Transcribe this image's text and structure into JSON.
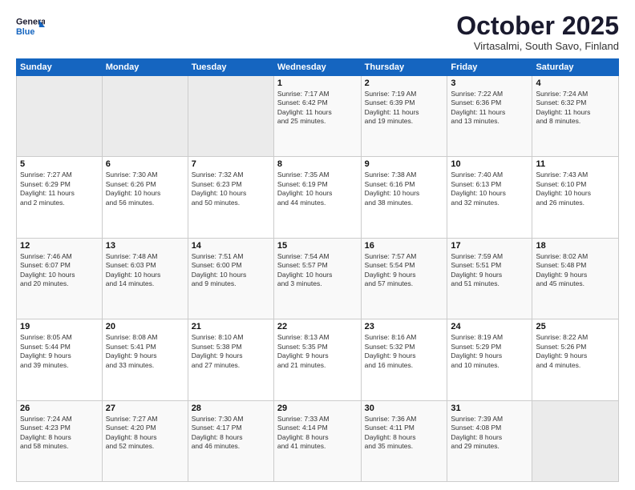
{
  "logo": {
    "line1": "General",
    "line2": "Blue"
  },
  "title": "October 2025",
  "subtitle": "Virtasalmi, South Savo, Finland",
  "days_of_week": [
    "Sunday",
    "Monday",
    "Tuesday",
    "Wednesday",
    "Thursday",
    "Friday",
    "Saturday"
  ],
  "weeks": [
    [
      {
        "day": "",
        "info": ""
      },
      {
        "day": "",
        "info": ""
      },
      {
        "day": "",
        "info": ""
      },
      {
        "day": "1",
        "info": "Sunrise: 7:17 AM\nSunset: 6:42 PM\nDaylight: 11 hours\nand 25 minutes."
      },
      {
        "day": "2",
        "info": "Sunrise: 7:19 AM\nSunset: 6:39 PM\nDaylight: 11 hours\nand 19 minutes."
      },
      {
        "day": "3",
        "info": "Sunrise: 7:22 AM\nSunset: 6:36 PM\nDaylight: 11 hours\nand 13 minutes."
      },
      {
        "day": "4",
        "info": "Sunrise: 7:24 AM\nSunset: 6:32 PM\nDaylight: 11 hours\nand 8 minutes."
      }
    ],
    [
      {
        "day": "5",
        "info": "Sunrise: 7:27 AM\nSunset: 6:29 PM\nDaylight: 11 hours\nand 2 minutes."
      },
      {
        "day": "6",
        "info": "Sunrise: 7:30 AM\nSunset: 6:26 PM\nDaylight: 10 hours\nand 56 minutes."
      },
      {
        "day": "7",
        "info": "Sunrise: 7:32 AM\nSunset: 6:23 PM\nDaylight: 10 hours\nand 50 minutes."
      },
      {
        "day": "8",
        "info": "Sunrise: 7:35 AM\nSunset: 6:19 PM\nDaylight: 10 hours\nand 44 minutes."
      },
      {
        "day": "9",
        "info": "Sunrise: 7:38 AM\nSunset: 6:16 PM\nDaylight: 10 hours\nand 38 minutes."
      },
      {
        "day": "10",
        "info": "Sunrise: 7:40 AM\nSunset: 6:13 PM\nDaylight: 10 hours\nand 32 minutes."
      },
      {
        "day": "11",
        "info": "Sunrise: 7:43 AM\nSunset: 6:10 PM\nDaylight: 10 hours\nand 26 minutes."
      }
    ],
    [
      {
        "day": "12",
        "info": "Sunrise: 7:46 AM\nSunset: 6:07 PM\nDaylight: 10 hours\nand 20 minutes."
      },
      {
        "day": "13",
        "info": "Sunrise: 7:48 AM\nSunset: 6:03 PM\nDaylight: 10 hours\nand 14 minutes."
      },
      {
        "day": "14",
        "info": "Sunrise: 7:51 AM\nSunset: 6:00 PM\nDaylight: 10 hours\nand 9 minutes."
      },
      {
        "day": "15",
        "info": "Sunrise: 7:54 AM\nSunset: 5:57 PM\nDaylight: 10 hours\nand 3 minutes."
      },
      {
        "day": "16",
        "info": "Sunrise: 7:57 AM\nSunset: 5:54 PM\nDaylight: 9 hours\nand 57 minutes."
      },
      {
        "day": "17",
        "info": "Sunrise: 7:59 AM\nSunset: 5:51 PM\nDaylight: 9 hours\nand 51 minutes."
      },
      {
        "day": "18",
        "info": "Sunrise: 8:02 AM\nSunset: 5:48 PM\nDaylight: 9 hours\nand 45 minutes."
      }
    ],
    [
      {
        "day": "19",
        "info": "Sunrise: 8:05 AM\nSunset: 5:44 PM\nDaylight: 9 hours\nand 39 minutes."
      },
      {
        "day": "20",
        "info": "Sunrise: 8:08 AM\nSunset: 5:41 PM\nDaylight: 9 hours\nand 33 minutes."
      },
      {
        "day": "21",
        "info": "Sunrise: 8:10 AM\nSunset: 5:38 PM\nDaylight: 9 hours\nand 27 minutes."
      },
      {
        "day": "22",
        "info": "Sunrise: 8:13 AM\nSunset: 5:35 PM\nDaylight: 9 hours\nand 21 minutes."
      },
      {
        "day": "23",
        "info": "Sunrise: 8:16 AM\nSunset: 5:32 PM\nDaylight: 9 hours\nand 16 minutes."
      },
      {
        "day": "24",
        "info": "Sunrise: 8:19 AM\nSunset: 5:29 PM\nDaylight: 9 hours\nand 10 minutes."
      },
      {
        "day": "25",
        "info": "Sunrise: 8:22 AM\nSunset: 5:26 PM\nDaylight: 9 hours\nand 4 minutes."
      }
    ],
    [
      {
        "day": "26",
        "info": "Sunrise: 7:24 AM\nSunset: 4:23 PM\nDaylight: 8 hours\nand 58 minutes."
      },
      {
        "day": "27",
        "info": "Sunrise: 7:27 AM\nSunset: 4:20 PM\nDaylight: 8 hours\nand 52 minutes."
      },
      {
        "day": "28",
        "info": "Sunrise: 7:30 AM\nSunset: 4:17 PM\nDaylight: 8 hours\nand 46 minutes."
      },
      {
        "day": "29",
        "info": "Sunrise: 7:33 AM\nSunset: 4:14 PM\nDaylight: 8 hours\nand 41 minutes."
      },
      {
        "day": "30",
        "info": "Sunrise: 7:36 AM\nSunset: 4:11 PM\nDaylight: 8 hours\nand 35 minutes."
      },
      {
        "day": "31",
        "info": "Sunrise: 7:39 AM\nSunset: 4:08 PM\nDaylight: 8 hours\nand 29 minutes."
      },
      {
        "day": "",
        "info": ""
      }
    ]
  ]
}
